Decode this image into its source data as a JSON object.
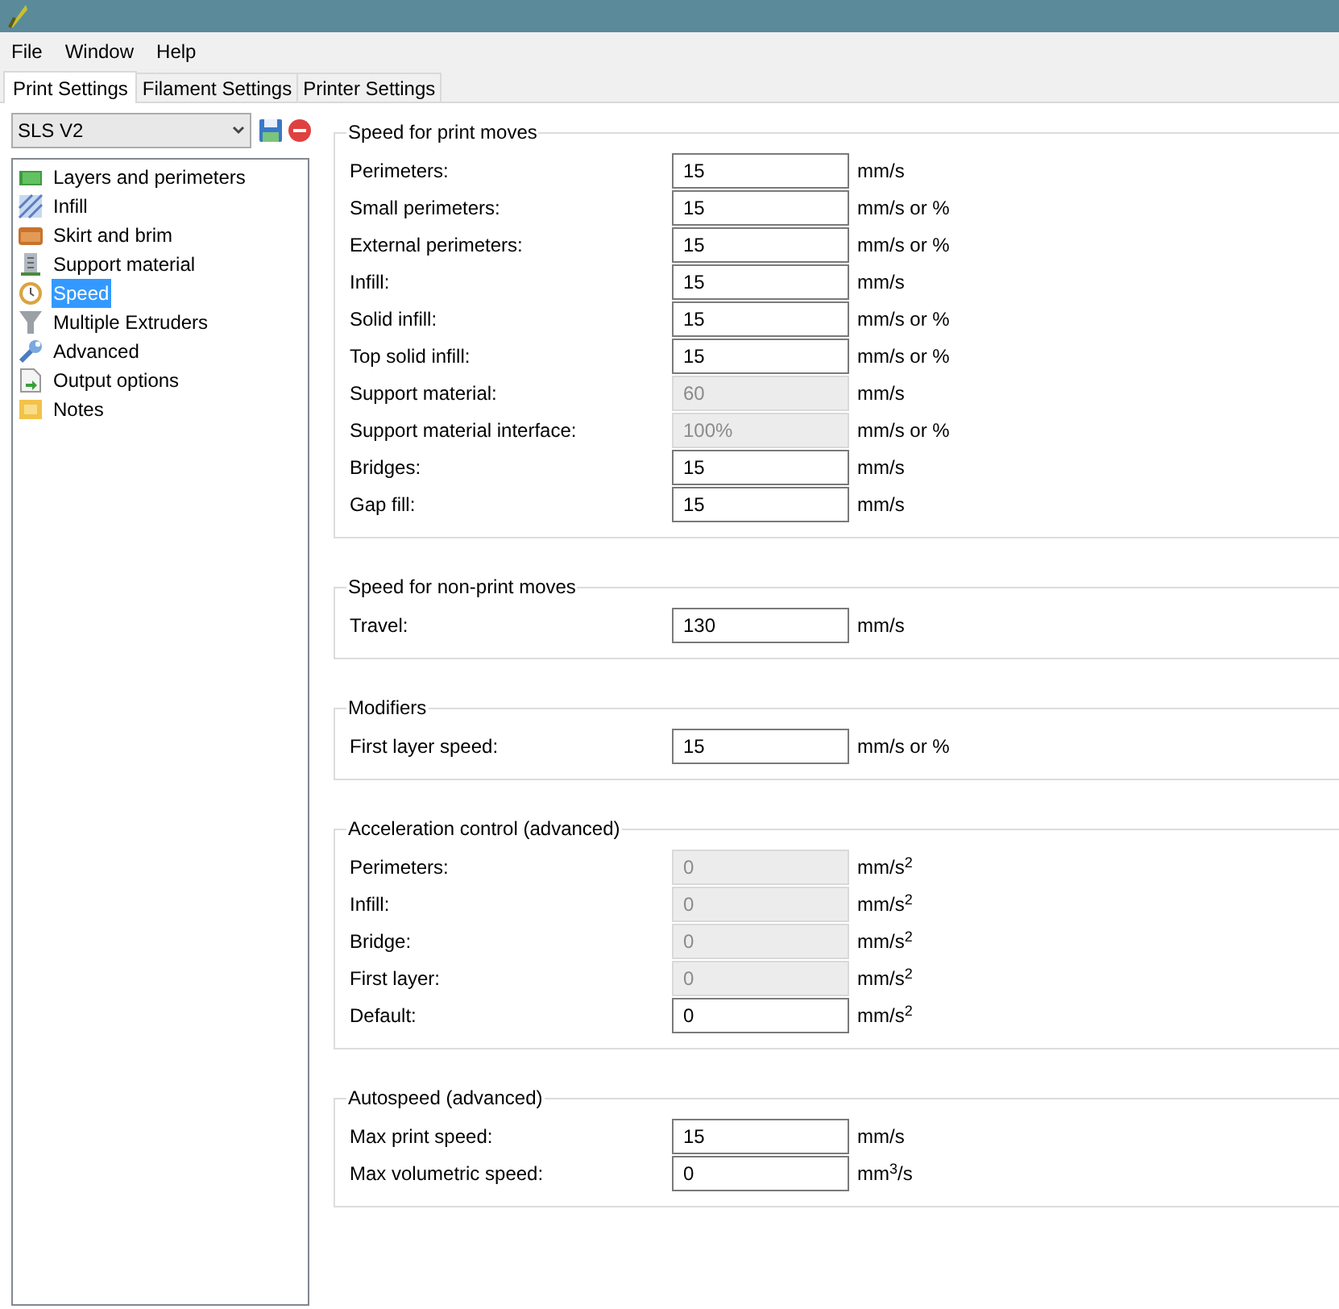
{
  "menu": [
    "File",
    "Window",
    "Help"
  ],
  "tabs": [
    {
      "label": "Print Settings",
      "selected": true
    },
    {
      "label": "Filament Settings",
      "selected": false
    },
    {
      "label": "Printer Settings",
      "selected": false
    }
  ],
  "preset": {
    "value": "SLS V2"
  },
  "sidebar": {
    "items": [
      {
        "label": "Layers and perimeters",
        "kind": "layers",
        "selected": false
      },
      {
        "label": "Infill",
        "kind": "infill",
        "selected": false
      },
      {
        "label": "Skirt and brim",
        "kind": "skirt",
        "selected": false
      },
      {
        "label": "Support material",
        "kind": "support",
        "selected": false
      },
      {
        "label": "Speed",
        "kind": "speed",
        "selected": true
      },
      {
        "label": "Multiple Extruders",
        "kind": "extruders",
        "selected": false
      },
      {
        "label": "Advanced",
        "kind": "advanced",
        "selected": false
      },
      {
        "label": "Output options",
        "kind": "output",
        "selected": false
      },
      {
        "label": "Notes",
        "kind": "notes",
        "selected": false
      }
    ]
  },
  "groups": [
    {
      "title": "Speed for print moves",
      "rows": [
        {
          "label": "Perimeters:",
          "value": "15",
          "unit": "mm/s",
          "disabled": false
        },
        {
          "label": "Small perimeters:",
          "value": "15",
          "unit": "mm/s or %",
          "disabled": false
        },
        {
          "label": "External perimeters:",
          "value": "15",
          "unit": "mm/s or %",
          "disabled": false
        },
        {
          "label": "Infill:",
          "value": "15",
          "unit": "mm/s",
          "disabled": false
        },
        {
          "label": "Solid infill:",
          "value": "15",
          "unit": "mm/s or %",
          "disabled": false
        },
        {
          "label": "Top solid infill:",
          "value": "15",
          "unit": "mm/s or %",
          "disabled": false
        },
        {
          "label": "Support material:",
          "value": "60",
          "unit": "mm/s",
          "disabled": true
        },
        {
          "label": "Support material interface:",
          "value": "100%",
          "unit": "mm/s or %",
          "disabled": true
        },
        {
          "label": "Bridges:",
          "value": "15",
          "unit": "mm/s",
          "disabled": false
        },
        {
          "label": "Gap fill:",
          "value": "15",
          "unit": "mm/s",
          "disabled": false
        }
      ]
    },
    {
      "title": "Speed for non-print moves",
      "rows": [
        {
          "label": "Travel:",
          "value": "130",
          "unit": "mm/s",
          "disabled": false
        }
      ]
    },
    {
      "title": "Modifiers",
      "rows": [
        {
          "label": "First layer speed:",
          "value": "15",
          "unit": "mm/s or %",
          "disabled": false
        }
      ]
    },
    {
      "title": "Acceleration control (advanced)",
      "rows": [
        {
          "label": "Perimeters:",
          "value": "0",
          "unit": "mm/s$^{2}$",
          "disabled": true
        },
        {
          "label": "Infill:",
          "value": "0",
          "unit": "mm/s$^{2}$",
          "disabled": true
        },
        {
          "label": "Bridge:",
          "value": "0",
          "unit": "mm/s$^{2}$",
          "disabled": true
        },
        {
          "label": "First layer:",
          "value": "0",
          "unit": "mm/s$^{2}$",
          "disabled": true
        },
        {
          "label": "Default:",
          "value": "0",
          "unit": "mm/s$^{2}$",
          "disabled": false
        }
      ]
    },
    {
      "title": "Autospeed (advanced)",
      "rows": [
        {
          "label": "Max print speed:",
          "value": "15",
          "unit": "mm/s",
          "disabled": false
        },
        {
          "label": "Max volumetric speed:",
          "value": "0",
          "unit": "mm$^{3}$/s",
          "disabled": false
        }
      ]
    }
  ]
}
